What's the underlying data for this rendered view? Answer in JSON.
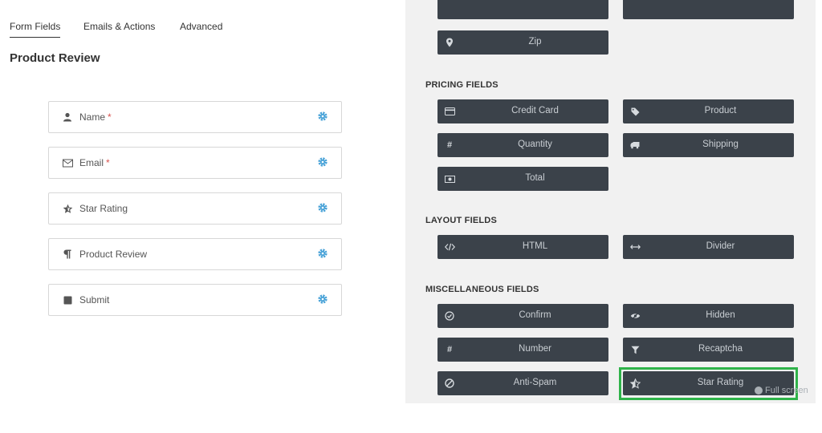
{
  "tabs": [
    "Form Fields",
    "Emails & Actions",
    "Advanced"
  ],
  "form": {
    "title": "Product Review",
    "fields": [
      {
        "label": "Name",
        "required_mark": "*",
        "icon": "user-icon"
      },
      {
        "label": "Email",
        "required_mark": "*",
        "icon": "envelope-icon"
      },
      {
        "label": "Star Rating",
        "required_mark": "",
        "icon": "star-icon"
      },
      {
        "label": "Product Review",
        "required_mark": "",
        "icon": "paragraph-icon"
      },
      {
        "label": "Submit",
        "required_mark": "",
        "icon": "square-icon"
      }
    ]
  },
  "panel": {
    "top_buttons": [
      {
        "label": "",
        "icon": "none"
      },
      {
        "label": "",
        "icon": "none"
      },
      {
        "label": "Zip",
        "icon": "map-marker-icon"
      }
    ],
    "sections": [
      {
        "title": "PRICING FIELDS",
        "buttons": [
          {
            "label": "Credit Card",
            "icon": "credit-card-icon"
          },
          {
            "label": "Product",
            "icon": "tag-icon"
          },
          {
            "label": "Quantity",
            "icon": "hash-icon"
          },
          {
            "label": "Shipping",
            "icon": "truck-icon"
          },
          {
            "label": "Total",
            "icon": "money-icon"
          }
        ]
      },
      {
        "title": "LAYOUT FIELDS",
        "buttons": [
          {
            "label": "HTML",
            "icon": "code-icon"
          },
          {
            "label": "Divider",
            "icon": "arrows-h-icon"
          }
        ]
      },
      {
        "title": "MISCELLANEOUS FIELDS",
        "buttons": [
          {
            "label": "Confirm",
            "icon": "check-circle-icon"
          },
          {
            "label": "Hidden",
            "icon": "eye-slash-icon"
          },
          {
            "label": "Number",
            "icon": "hash-icon"
          },
          {
            "label": "Recaptcha",
            "icon": "filter-icon"
          },
          {
            "label": "Anti-Spam",
            "icon": "ban-icon"
          },
          {
            "label": "Star Rating",
            "icon": "star-half-icon"
          }
        ]
      }
    ],
    "full_screen": "Full screen"
  },
  "colors": {
    "button_bg": "#3b424a",
    "panel_bg": "#f1f1f1",
    "gear": "#4aa3d8",
    "highlight": "#2fb34a",
    "required": "#d9534f"
  }
}
